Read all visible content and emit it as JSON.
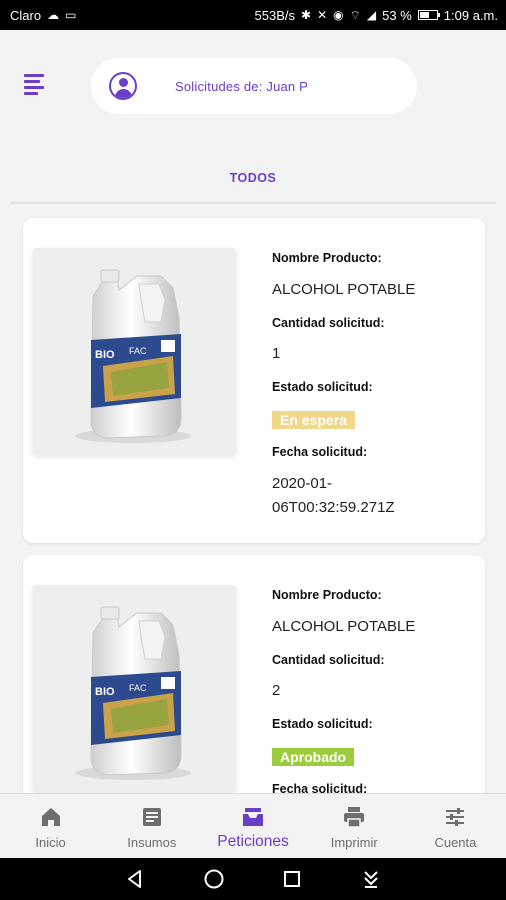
{
  "status_bar": {
    "carrier": "Claro",
    "network_speed": "553B/s",
    "battery": "53 %",
    "battery_level": 0.53,
    "time": "1:09 a.m."
  },
  "header": {
    "search_text": "Solicitudes de: Juan P"
  },
  "tabs": {
    "todos": "TODOS"
  },
  "labels": {
    "product_name": "Nombre Producto:",
    "quantity": "Cantidad solicitud:",
    "status": "Estado solicitud:",
    "date": "Fecha solicitud:"
  },
  "requests": [
    {
      "product": "ALCOHOL POTABLE",
      "quantity": "1",
      "status": "En espera",
      "status_color": "#f0d78a",
      "date_line1": "2020-01-",
      "date_line2": "06T00:32:59.271Z",
      "image_brand": "BIO",
      "image_brand2": "FAC"
    },
    {
      "product": "ALCOHOL POTABLE",
      "quantity": "2",
      "status": "Aprobado",
      "status_color": "#9ccc3c",
      "image_brand": "BIO",
      "image_brand2": "FAC"
    }
  ],
  "bottom_nav": {
    "items": [
      {
        "label": "Inicio",
        "icon": "home-icon"
      },
      {
        "label": "Insumos",
        "icon": "document-icon"
      },
      {
        "label": "Peticiones",
        "icon": "inbox-icon"
      },
      {
        "label": "Imprimir",
        "icon": "printer-icon"
      },
      {
        "label": "Cuenta",
        "icon": "sliders-icon"
      }
    ],
    "active_index": 2
  },
  "colors": {
    "accent": "#6a3fc8",
    "background": "#f3f3f3"
  }
}
